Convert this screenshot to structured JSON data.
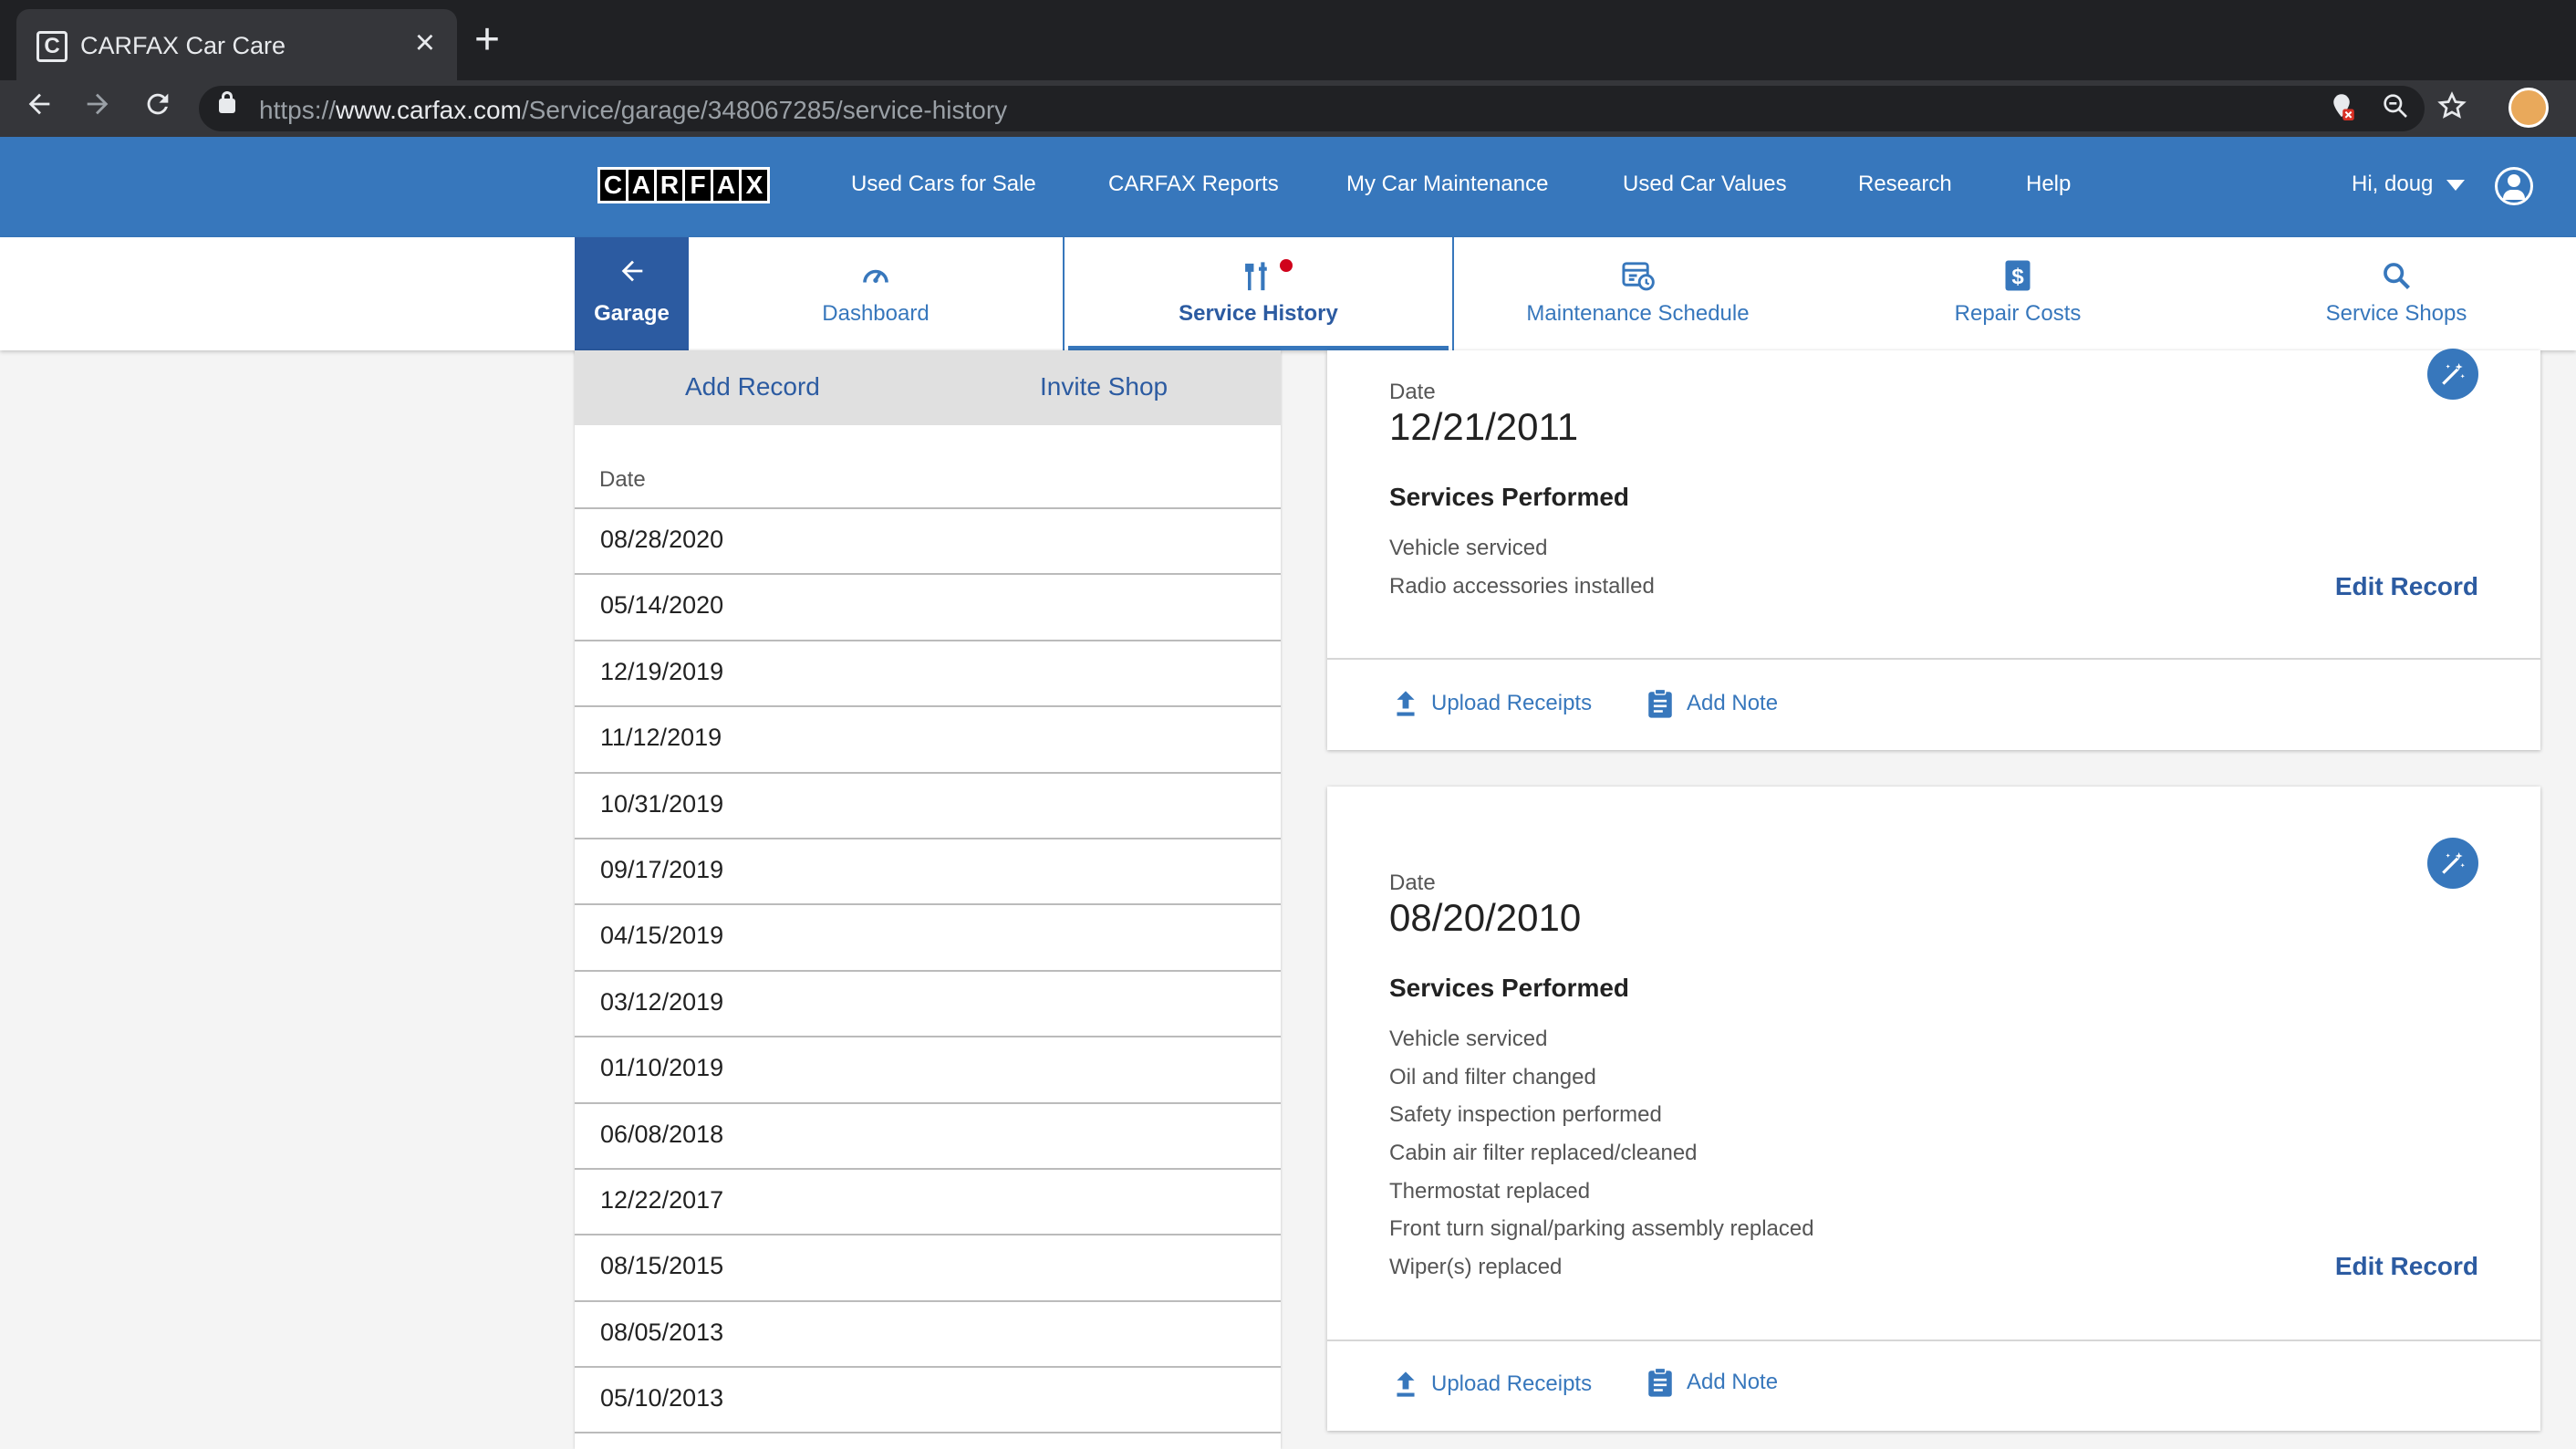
{
  "browser": {
    "tab_title": "CARFAX Car Care",
    "favicon_letter": "C",
    "url_prefix": "https://",
    "url_host": "www.carfax.com",
    "url_path": "/Service/garage/348067285/service-history"
  },
  "header": {
    "logo_letters": [
      "C",
      "A",
      "R",
      "F",
      "A",
      "X"
    ],
    "nav": [
      "Used Cars for Sale",
      "CARFAX Reports",
      "My Car Maintenance",
      "Used Car Values",
      "Research",
      "Help"
    ],
    "user_greeting": "Hi, doug",
    "brand_color": "#3777bc"
  },
  "subnav": {
    "garage": "Garage",
    "tabs": [
      "Dashboard",
      "Service History",
      "Maintenance Schedule",
      "Repair Costs",
      "Service Shops"
    ],
    "active_tab": "Service History"
  },
  "sidebar": {
    "add_record": "Add Record",
    "invite_shop": "Invite Shop",
    "date_header": "Date",
    "dates": [
      "08/28/2020",
      "05/14/2020",
      "12/19/2019",
      "11/12/2019",
      "10/31/2019",
      "09/17/2019",
      "04/15/2019",
      "03/12/2019",
      "01/10/2019",
      "06/08/2018",
      "12/22/2017",
      "08/15/2015",
      "08/05/2013",
      "05/10/2013"
    ]
  },
  "records": [
    {
      "date_label": "Date",
      "date": "12/21/2011",
      "services_title": "Services Performed",
      "services": [
        "Vehicle serviced",
        "Radio accessories installed"
      ],
      "edit": "Edit Record",
      "upload": "Upload Receipts",
      "note": "Add Note"
    },
    {
      "date_label": "Date",
      "date": "08/20/2010",
      "services_title": "Services Performed",
      "services": [
        "Vehicle serviced",
        "Oil and filter changed",
        "Safety inspection performed",
        "Cabin air filter replaced/cleaned",
        "Thermostat replaced",
        "Front turn signal/parking assembly replaced",
        "Wiper(s) replaced"
      ],
      "edit": "Edit Record",
      "upload": "Upload Receipts",
      "note": "Add Note"
    }
  ]
}
